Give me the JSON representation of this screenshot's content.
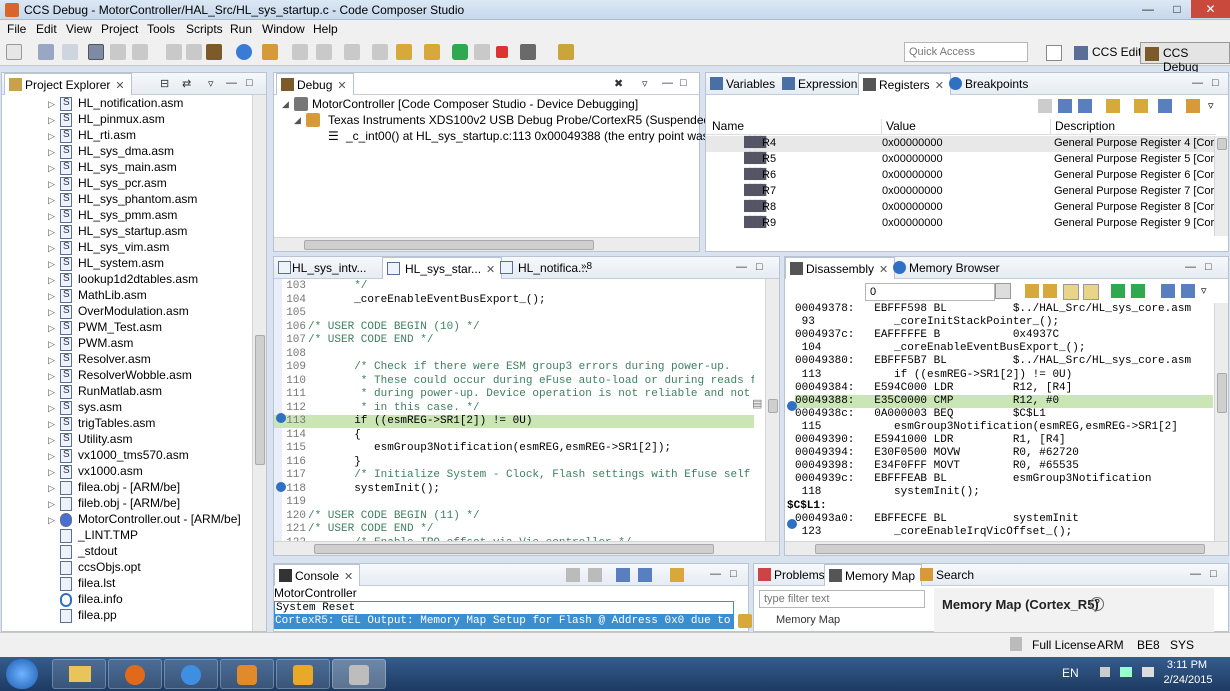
{
  "window": {
    "title": "CCS Debug - MotorController/HAL_Src/HL_sys_startup.c - Code Composer Studio"
  },
  "menu": [
    "File",
    "Edit",
    "View",
    "Project",
    "Tools",
    "Scripts",
    "Run",
    "Window",
    "Help"
  ],
  "toolbar": {
    "quick_access_placeholder": "Quick Access",
    "ccs_edit": "CCS Edit",
    "ccs_debug": "CCS Debug"
  },
  "project_explorer": {
    "tab": "Project Explorer",
    "items": [
      {
        "label": "HL_notification.asm",
        "type": "asm"
      },
      {
        "label": "HL_pinmux.asm",
        "type": "asm"
      },
      {
        "label": "HL_rti.asm",
        "type": "asm"
      },
      {
        "label": "HL_sys_dma.asm",
        "type": "asm"
      },
      {
        "label": "HL_sys_main.asm",
        "type": "asm"
      },
      {
        "label": "HL_sys_pcr.asm",
        "type": "asm"
      },
      {
        "label": "HL_sys_phantom.asm",
        "type": "asm"
      },
      {
        "label": "HL_sys_pmm.asm",
        "type": "asm"
      },
      {
        "label": "HL_sys_startup.asm",
        "type": "asm"
      },
      {
        "label": "HL_sys_vim.asm",
        "type": "asm"
      },
      {
        "label": "HL_system.asm",
        "type": "asm"
      },
      {
        "label": "lookup1d2dtables.asm",
        "type": "asm"
      },
      {
        "label": "MathLib.asm",
        "type": "asm"
      },
      {
        "label": "OverModulation.asm",
        "type": "asm"
      },
      {
        "label": "PWM_Test.asm",
        "type": "asm"
      },
      {
        "label": "PWM.asm",
        "type": "asm"
      },
      {
        "label": "Resolver.asm",
        "type": "asm"
      },
      {
        "label": "ResolverWobble.asm",
        "type": "asm"
      },
      {
        "label": "RunMatlab.asm",
        "type": "asm"
      },
      {
        "label": "sys.asm",
        "type": "asm"
      },
      {
        "label": "trigTables.asm",
        "type": "asm"
      },
      {
        "label": "Utility.asm",
        "type": "asm"
      },
      {
        "label": "vx1000_tms570.asm",
        "type": "asm"
      },
      {
        "label": "vx1000.asm",
        "type": "asm"
      },
      {
        "label": "filea.obj - [ARM/be]",
        "type": "obj"
      },
      {
        "label": "fileb.obj - [ARM/be]",
        "type": "obj"
      },
      {
        "label": "MotorController.out - [ARM/be]",
        "type": "out"
      },
      {
        "label": "_LINT.TMP",
        "type": "file"
      },
      {
        "label": "_stdout",
        "type": "file"
      },
      {
        "label": "ccsObjs.opt",
        "type": "file"
      },
      {
        "label": "filea.lst",
        "type": "file"
      },
      {
        "label": "filea.info",
        "type": "info"
      },
      {
        "label": "filea.pp",
        "type": "file"
      }
    ]
  },
  "debug": {
    "tab": "Debug",
    "tree": [
      "MotorController [Code Composer Studio - Device Debugging]",
      "Texas Instruments XDS100v2 USB Debug Probe/CortexR5 (Suspended - HW Bre",
      "_c_int00() at HL_sys_startup.c:113 0x00049388  (the entry point was reached"
    ]
  },
  "registers": {
    "tabs": [
      "Variables",
      "Expressions",
      "Registers",
      "Breakpoints"
    ],
    "columns": [
      "Name",
      "Value",
      "Description"
    ],
    "rows": [
      {
        "name": "R4",
        "value": "0x00000000",
        "desc": "General Purpose Register 4 [Core]"
      },
      {
        "name": "R5",
        "value": "0x00000000",
        "desc": "General Purpose Register 5 [Core]"
      },
      {
        "name": "R6",
        "value": "0x00000000",
        "desc": "General Purpose Register 6 [Core]"
      },
      {
        "name": "R7",
        "value": "0x00000000",
        "desc": "General Purpose Register 7 [Core]"
      },
      {
        "name": "R8",
        "value": "0x00000000",
        "desc": "General Purpose Register 8 [Core]"
      },
      {
        "name": "R9",
        "value": "0x00000000",
        "desc": "General Purpose Register 9 [Core]"
      }
    ]
  },
  "editor": {
    "tabs": [
      "HL_sys_intv...",
      "HL_sys_star...",
      "HL_notifica...",
      "»8"
    ],
    "lines": [
      {
        "n": "103",
        "t": "       */",
        "c": "cm"
      },
      {
        "n": "104",
        "t": "       _coreEnableEventBusExport_();",
        "c": ""
      },
      {
        "n": "105",
        "t": "",
        "c": ""
      },
      {
        "n": "106",
        "t": "/* USER CODE BEGIN (10) */",
        "c": "cm"
      },
      {
        "n": "107",
        "t": "/* USER CODE END */",
        "c": "cm"
      },
      {
        "n": "108",
        "t": "",
        "c": ""
      },
      {
        "n": "109",
        "t": "       /* Check if there were ESM group3 errors during power-up.",
        "c": "cm"
      },
      {
        "n": "110",
        "t": "        * These could occur during eFuse auto-load or during reads fro",
        "c": "cm"
      },
      {
        "n": "111",
        "t": "        * during power-up. Device operation is not reliable and not re",
        "c": "cm"
      },
      {
        "n": "112",
        "t": "        * in this case. */",
        "c": "cm"
      },
      {
        "n": "113",
        "t": "       if ((esmREG->SR1[2]) != 0U)",
        "c": "hl"
      },
      {
        "n": "114",
        "t": "       {",
        "c": ""
      },
      {
        "n": "115",
        "t": "          esmGroup3Notification(esmREG,esmREG->SR1[2]);",
        "c": ""
      },
      {
        "n": "116",
        "t": "       }",
        "c": ""
      },
      {
        "n": "117",
        "t": "       /* Initialize System - Clock, Flash settings with Efuse self ch",
        "c": "cm"
      },
      {
        "n": "118",
        "t": "       systemInit();",
        "c": ""
      },
      {
        "n": "119",
        "t": "",
        "c": ""
      },
      {
        "n": "120",
        "t": "/* USER CODE BEGIN (11) */",
        "c": "cm"
      },
      {
        "n": "121",
        "t": "/* USER CODE END */",
        "c": "cm"
      },
      {
        "n": "122",
        "t": "       /* Enable IRQ offset via Vic controller */",
        "c": "cm"
      }
    ]
  },
  "disassembly": {
    "tabs": [
      "Disassembly",
      "Memory Browser"
    ],
    "address_value": "0",
    "lines": [
      {
        "t": "00049378:   EBFFF598 BL          $../HAL_Src/HL_sys_core.asm",
        "hl": false,
        "lbl": false
      },
      {
        "t": " 93            _coreInitStackPointer_();",
        "hl": false,
        "lbl": false
      },
      {
        "t": "0004937c:   EAFFFFFE B           0x4937C",
        "hl": false,
        "lbl": false
      },
      {
        "t": " 104           _coreEnableEventBusExport_();",
        "hl": false,
        "lbl": false
      },
      {
        "t": "00049380:   EBFFF5B7 BL          $../HAL_Src/HL_sys_core.asm",
        "hl": false,
        "lbl": false
      },
      {
        "t": " 113           if ((esmREG->SR1[2]) != 0U)",
        "hl": false,
        "lbl": false
      },
      {
        "t": "00049384:   E594C000 LDR         R12, [R4]",
        "hl": false,
        "lbl": false
      },
      {
        "t": "00049388:   E35C0000 CMP         R12, #0",
        "hl": true,
        "lbl": false
      },
      {
        "t": "0004938c:   0A000003 BEQ         $C$L1",
        "hl": false,
        "lbl": false
      },
      {
        "t": " 115           esmGroup3Notification(esmREG,esmREG->SR1[2]",
        "hl": false,
        "lbl": false
      },
      {
        "t": "00049390:   E5941000 LDR         R1, [R4]",
        "hl": false,
        "lbl": false
      },
      {
        "t": "00049394:   E30F0500 MOVW        R0, #62720",
        "hl": false,
        "lbl": false
      },
      {
        "t": "00049398:   E34F0FFF MOVT        R0, #65535",
        "hl": false,
        "lbl": false
      },
      {
        "t": "0004939c:   EBFFFEAB BL          esmGroup3Notification",
        "hl": false,
        "lbl": false
      },
      {
        "t": " 118           systemInit();",
        "hl": false,
        "lbl": false
      },
      {
        "t": "$C$L1:",
        "hl": false,
        "lbl": true
      },
      {
        "t": "000493a0:   EBFFECFE BL          systemInit",
        "hl": false,
        "lbl": false
      },
      {
        "t": " 123           _coreEnableIrqVicOffset_();",
        "hl": false,
        "lbl": false
      }
    ]
  },
  "console": {
    "tab": "Console",
    "project": "MotorController",
    "lines": [
      "System Reset",
      "CortexR5: GEL Output:   Memory Map Setup for Flash @ Address 0x0 due to"
    ]
  },
  "memory_map": {
    "tabs": [
      "Problems",
      "Memory Map",
      "Search"
    ],
    "filter_placeholder": "type filter text",
    "title": "Memory Map (Cortex_R5)",
    "item": "Memory Map"
  },
  "status": {
    "license": "Full License",
    "arch": "ARM",
    "endian": "BE8",
    "mode": "SYS"
  },
  "taskbar": {
    "lang": "EN",
    "time": "3:11 PM",
    "date": "2/24/2015"
  }
}
